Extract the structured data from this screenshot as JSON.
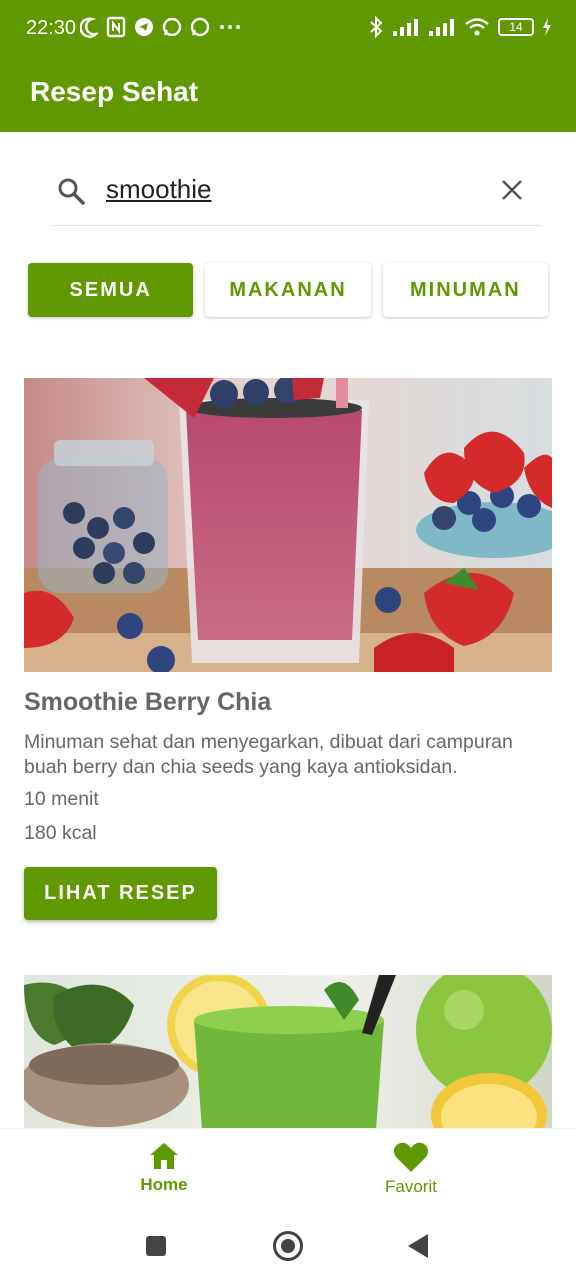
{
  "status_bar": {
    "time": "22:30",
    "battery": "14"
  },
  "app_bar": {
    "title": "Resep Sehat"
  },
  "search": {
    "value": "smoothie"
  },
  "filters": [
    {
      "label": "SEMUA",
      "active": true
    },
    {
      "label": "MAKANAN",
      "active": false
    },
    {
      "label": "MINUMAN",
      "active": false
    }
  ],
  "recipe": {
    "title": "Smoothie Berry Chia",
    "description": "Minuman sehat dan menyegarkan, dibuat dari campuran buah berry dan chia seeds yang kaya antioksidan.",
    "time": "10 menit",
    "calories": "180 kcal",
    "button_label": "LIHAT RESEP"
  },
  "bottom_nav": {
    "home": "Home",
    "favorites": "Favorit"
  },
  "colors": {
    "primary": "#5f9800",
    "text_gray": "#666666"
  }
}
